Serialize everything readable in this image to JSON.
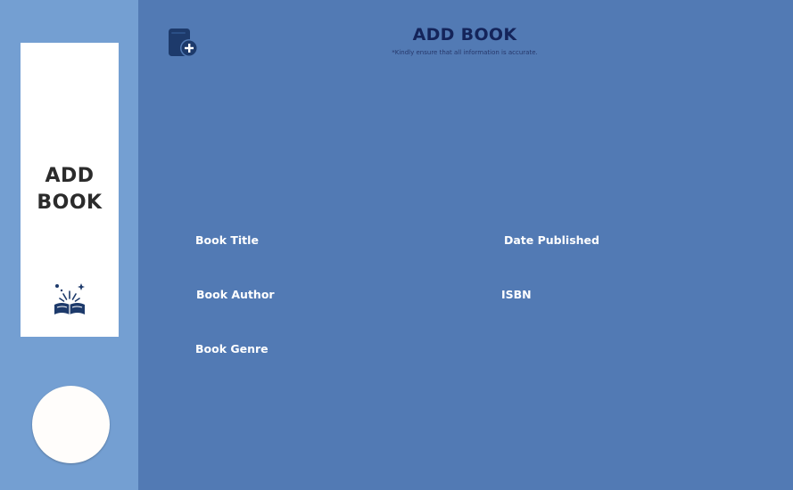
{
  "sidebar": {
    "card_title_line1": "ADD",
    "card_title_line2": "BOOK",
    "card_icon": "open-book-sparkle-icon",
    "avatar_icon": "user-avatar"
  },
  "header": {
    "icon": "add-book-icon",
    "title": "ADD BOOK",
    "subtitle": "*Kindly ensure that all information is accurate."
  },
  "form": {
    "book_title_label": "Book Title",
    "date_published_label": "Date Published",
    "book_author_label": "Book Author",
    "isbn_label": "ISBN",
    "book_genre_label": "Book Genre"
  },
  "colors": {
    "main_bg": "#527ab4",
    "sidebar_bg": "#749fd2",
    "title_color": "#14245a",
    "icon_color": "#1d3a6b"
  }
}
